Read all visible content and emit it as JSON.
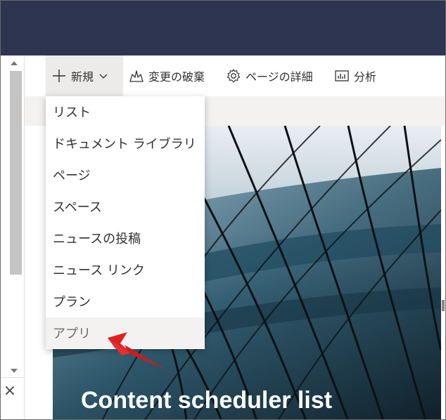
{
  "command_bar": {
    "new_label": "新規",
    "discard_label": "変更の破棄",
    "page_details_label": "ページの詳細",
    "analytics_label": "分析"
  },
  "new_menu": {
    "items": [
      {
        "label": "リスト"
      },
      {
        "label": "ドキュメント ライブラリ"
      },
      {
        "label": "ページ"
      },
      {
        "label": "スペース"
      },
      {
        "label": "ニュースの投稿"
      },
      {
        "label": "ニュース リンク"
      },
      {
        "label": "プラン"
      },
      {
        "label": "アプリ",
        "highlighted": true
      }
    ]
  },
  "hero": {
    "title": "Content scheduler list"
  },
  "colors": {
    "topbar": "#2d3550",
    "annotation_arrow": "#e02020",
    "menu_hover": "#f3f2f1"
  },
  "icons": [
    "plus-icon",
    "chevron-down-icon",
    "discard-icon",
    "gear-icon",
    "analytics-icon",
    "close-icon",
    "arrow-annotation-icon"
  ]
}
